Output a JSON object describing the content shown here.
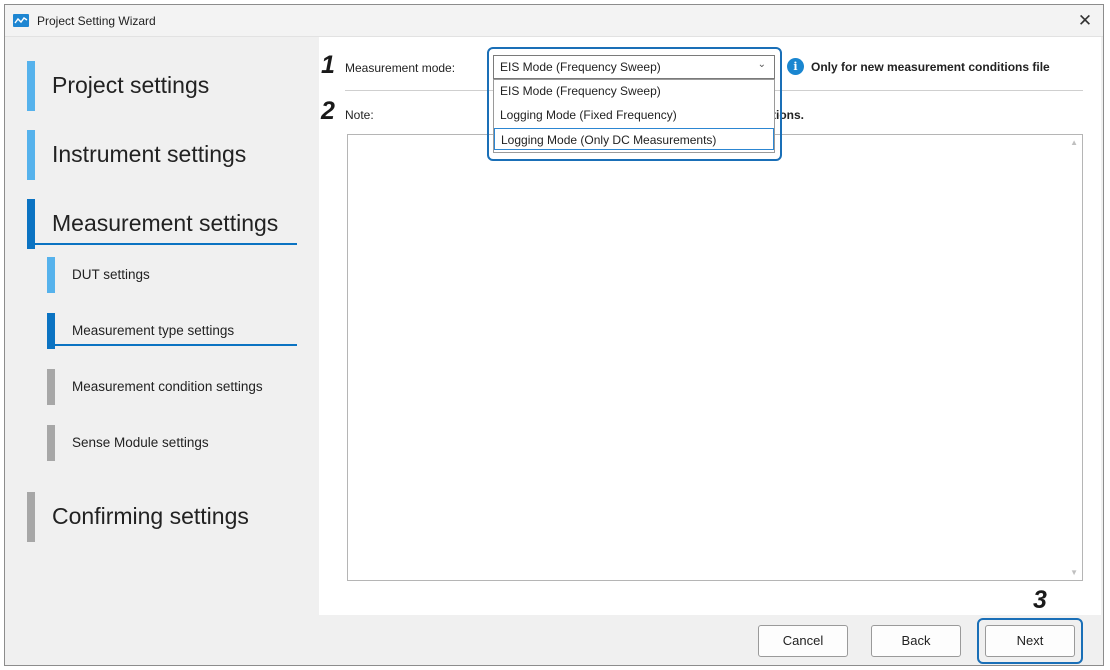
{
  "window": {
    "title": "Project Setting Wizard",
    "close_glyph": "✕"
  },
  "sidebar": {
    "items": [
      {
        "label": "Project settings",
        "state": "done"
      },
      {
        "label": "Instrument settings",
        "state": "done"
      },
      {
        "label": "Measurement settings",
        "state": "current"
      },
      {
        "label": "DUT settings",
        "state": "done"
      },
      {
        "label": "Measurement type settings",
        "state": "current"
      },
      {
        "label": "Measurement condition settings",
        "state": "pending"
      },
      {
        "label": "Sense Module settings",
        "state": "pending"
      },
      {
        "label": "Confirming settings",
        "state": "pending"
      }
    ]
  },
  "main": {
    "measurement_mode_label": "Measurement mode:",
    "dropdown": {
      "selected": "EIS Mode (Frequency Sweep)",
      "options": [
        "EIS Mode (Frequency Sweep)",
        "Logging Mode (Fixed Frequency)",
        "Logging Mode (Only DC Measurements)"
      ],
      "highlighted_option": "Logging Mode (Only DC Measurements)"
    },
    "info_icon_glyph": "i",
    "info_text": "Only for new measurement conditions file",
    "note_label": "Note:",
    "note_hidden_tail": "tions.",
    "note_value": ""
  },
  "callouts": [
    "1",
    "2",
    "3"
  ],
  "footer": {
    "cancel": "Cancel",
    "back": "Back",
    "next": "Next"
  },
  "colors": {
    "accent": "#0b73c2",
    "done_bar": "#56b2ec",
    "pending_bar": "#a7a7a7",
    "callout_border": "#1a6fb7"
  },
  "icons": {
    "app": "wave-icon",
    "close": "close-icon",
    "info": "info-icon",
    "dropdown": "chevron-down-icon"
  }
}
